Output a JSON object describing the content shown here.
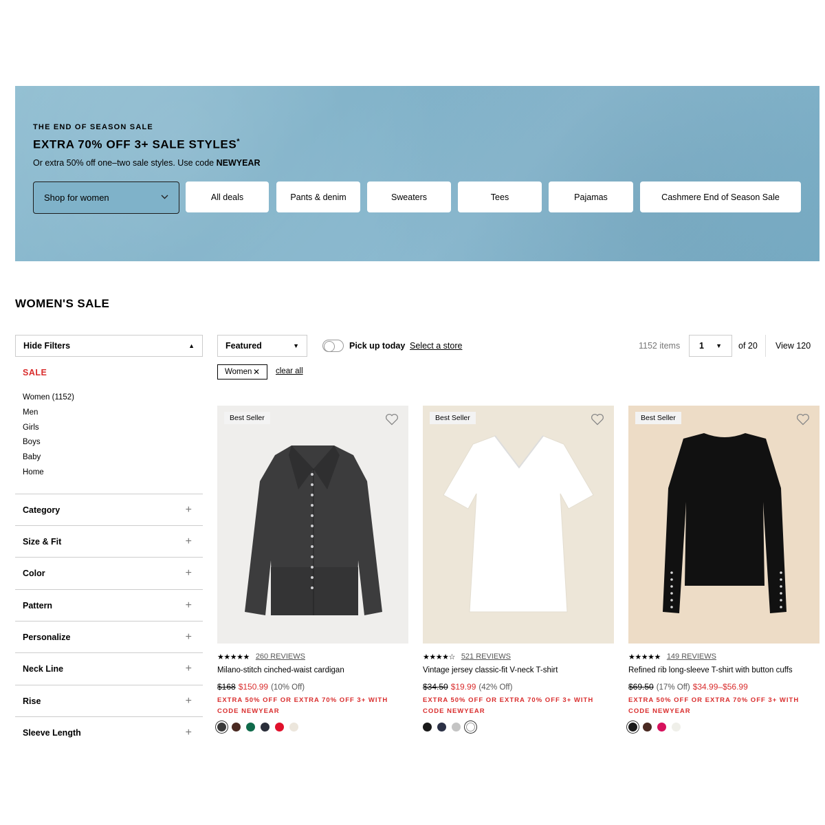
{
  "banner": {
    "eyebrow": "THE END OF SEASON SALE",
    "headline": "EXTRA 70% OFF 3+ SALE STYLES",
    "headline_mark": "*",
    "subline_prefix": "Or extra 50% off one–two sale styles. Use code ",
    "subline_code": "NEWYEAR",
    "shop_select": "Shop for women",
    "pills": [
      "All deals",
      "Pants & denim",
      "Sweaters",
      "Tees",
      "Pajamas",
      "Cashmere End of Season Sale"
    ]
  },
  "page_title": "WOMEN'S SALE",
  "sidebar": {
    "hide_filters": "Hide Filters",
    "sale_label": "SALE",
    "departments": [
      "Women (1152)",
      "Men",
      "Girls",
      "Boys",
      "Baby",
      "Home"
    ],
    "filters": [
      "Category",
      "Size & Fit",
      "Color",
      "Pattern",
      "Personalize",
      "Neck Line",
      "Rise",
      "Sleeve Length"
    ]
  },
  "toolbar": {
    "sort": "Featured",
    "pickup_label": "Pick up today",
    "select_store": "Select a store",
    "items_count": "1152 items",
    "page": "1",
    "of_pages": "of 20",
    "view_all": "View 120",
    "chip": "Women",
    "clear_all": "clear all"
  },
  "products": [
    {
      "badge": "Best Seller",
      "stars": "★★★★★",
      "reviews": "260 REVIEWS",
      "name": "Milano-stitch cinched-waist cardigan",
      "orig_price": "$168",
      "sale_price": "$150.99",
      "percent": "(10% Off)",
      "promo": "EXTRA 50% OFF OR EXTRA 70% OFF 3+ WITH CODE NEWYEAR",
      "image_bg": "#efeeec",
      "garment": "cardigan",
      "swatches": [
        "#3a3a3a",
        "#4a2a22",
        "#0f6a4a",
        "#2b2f3a",
        "#e0112b",
        "#ece6dc"
      ]
    },
    {
      "badge": "Best Seller",
      "stars": "★★★★☆",
      "reviews": "521 REVIEWS",
      "name": "Vintage jersey classic-fit V-neck T-shirt",
      "orig_price": "$34.50",
      "sale_price": "$19.99",
      "percent": "(42% Off)",
      "promo": "EXTRA 50% OFF OR EXTRA 70% OFF 3+ WITH CODE NEWYEAR",
      "image_bg": "#ede6d8",
      "garment": "vtee",
      "swatches": [
        "#1a1a1a",
        "#2c3146",
        "#c4c4c4",
        "#ffffff"
      ]
    },
    {
      "badge": "Best Seller",
      "stars": "★★★★★",
      "reviews": "149 REVIEWS",
      "name": "Refined rib long-sleeve T-shirt with button cuffs",
      "orig_price": "$69.50",
      "sale_price": "$34.99–$56.99",
      "percent": "(17% Off)",
      "promo": "EXTRA 50% OFF OR EXTRA 70% OFF 3+ WITH CODE NEWYEAR",
      "image_bg": "#eddcc6",
      "garment": "longsleeve",
      "swatches": [
        "#1a1a1a",
        "#4a2a22",
        "#d6115c",
        "#efefe9"
      ]
    }
  ]
}
